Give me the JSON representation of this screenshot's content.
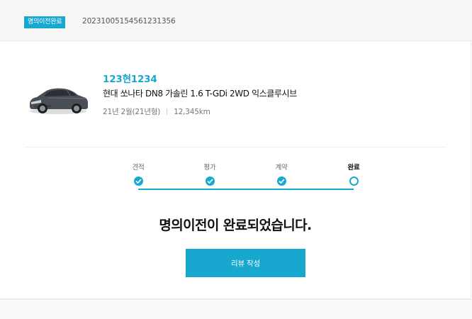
{
  "header": {
    "status_badge": "명의이전완료",
    "order_number": "20231005154561231356"
  },
  "vehicle": {
    "plate": "123현1234",
    "name": "현대 쏘나타 DN8 가솔린 1.6 T-GDi 2WD 익스클루시브",
    "year": "21년 2월(21년형)",
    "mileage": "12,345km",
    "image_icon": "car-image"
  },
  "progress": {
    "steps": [
      {
        "label": "견적",
        "state": "done"
      },
      {
        "label": "평가",
        "state": "done"
      },
      {
        "label": "계약",
        "state": "done"
      },
      {
        "label": "완료",
        "state": "current"
      }
    ]
  },
  "message": "명의이전이 완료되었습니다.",
  "review_button": "리뷰 작성",
  "colors": {
    "accent": "#18a7cf",
    "background_bar": "#f6f6f6"
  }
}
